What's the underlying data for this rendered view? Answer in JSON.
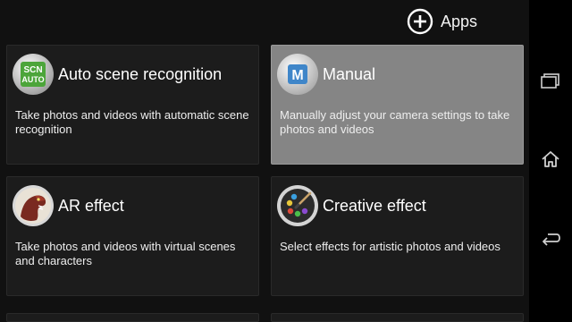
{
  "header": {
    "apps_label": "Apps",
    "apps_icon": "plus-circle-icon"
  },
  "modes": [
    {
      "icon": "scn-auto-icon",
      "icon_text_top": "SCN",
      "icon_text_bottom": "AUTO",
      "title": "Auto scene recognition",
      "description": "Take photos and videos with automatic scene recognition",
      "selected": false
    },
    {
      "icon": "manual-m-icon",
      "icon_text": "M",
      "title": "Manual",
      "description": "Manually adjust your camera settings to take photos and videos",
      "selected": true
    },
    {
      "icon": "dinosaur-icon",
      "title": "AR effect",
      "description": "Take photos and videos with virtual scenes and characters",
      "selected": false
    },
    {
      "icon": "paint-palette-icon",
      "title": "Creative effect",
      "description": "Select effects for artistic photos and videos",
      "selected": false
    }
  ],
  "navbar": {
    "recents_icon": "recent-apps-icon",
    "home_icon": "home-icon",
    "back_icon": "back-icon"
  },
  "colors": {
    "background": "#111111",
    "card": "#1c1c1c",
    "card_selected": "#858585",
    "navbar": "#000000"
  }
}
